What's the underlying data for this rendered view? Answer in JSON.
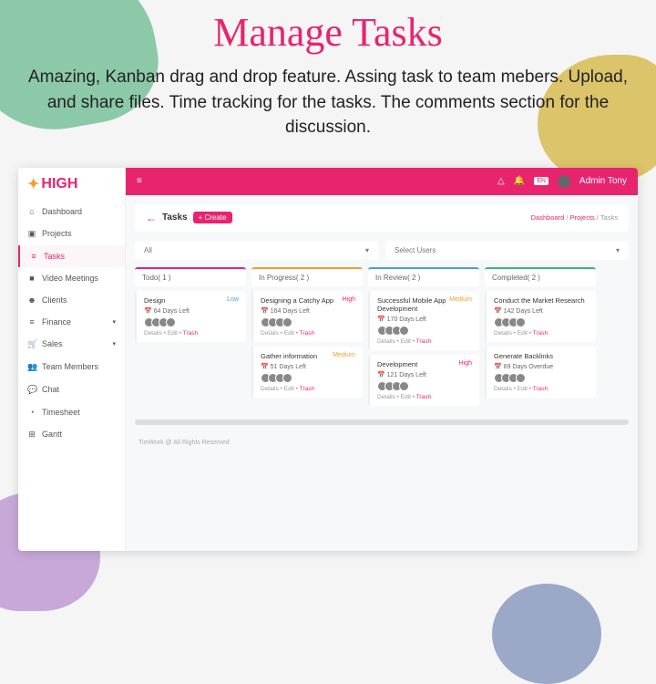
{
  "hero": {
    "title": "Manage Tasks",
    "desc": "Amazing, Kanban drag and drop feature. Assing task to team mebers. Upload, and share files. Time tracking for the tasks. The comments section for the discussion."
  },
  "brand": "HIGH",
  "nav": [
    {
      "icon": "⌂",
      "label": "Dashboard"
    },
    {
      "icon": "▣",
      "label": "Projects"
    },
    {
      "icon": "≡",
      "label": "Tasks",
      "active": true
    },
    {
      "icon": "■",
      "label": "Video Meetings"
    },
    {
      "icon": "☻",
      "label": "Clients"
    },
    {
      "icon": "≡",
      "label": "Finance",
      "caret": true
    },
    {
      "icon": "🛒",
      "label": "Sales",
      "caret": true
    },
    {
      "icon": "👥",
      "label": "Team Members"
    },
    {
      "icon": "💬",
      "label": "Chat"
    },
    {
      "icon": "◔",
      "label": "Timesheet"
    },
    {
      "icon": "⊞",
      "label": "Gantt"
    }
  ],
  "topbar": {
    "user": "Admin Tony"
  },
  "page": {
    "title": "Tasks",
    "create": "+ Create",
    "crumbs": [
      "Dashboard",
      "Projects",
      "Tasks"
    ]
  },
  "filters": {
    "all": "All",
    "users": "Select Users"
  },
  "columns": [
    {
      "title": "Todo( 1 )",
      "cards": [
        {
          "title": "Design",
          "prio": "Low",
          "days": "64 Days Left"
        }
      ]
    },
    {
      "title": "In Progress( 2 )",
      "cards": [
        {
          "title": "Designing a Catchy App",
          "prio": "High",
          "days": "164 Days Left"
        },
        {
          "title": "Gather information",
          "prio": "Medium",
          "days": "51 Days Left"
        }
      ]
    },
    {
      "title": "In Review( 2 )",
      "cards": [
        {
          "title": "Successful Mobile App Development",
          "prio": "Medium",
          "days": "170 Days Left"
        },
        {
          "title": "Development",
          "prio": "High",
          "days": "121 Days Left"
        }
      ]
    },
    {
      "title": "Completed( 2 )",
      "cards": [
        {
          "title": "Conduct the Market Research",
          "prio": "",
          "days": "142 Days Left"
        },
        {
          "title": "Generate Backlinks",
          "prio": "",
          "days": "69 Days Overdue"
        }
      ]
    }
  ],
  "card_actions": {
    "details": "Details",
    "edit": "Edit",
    "trash": "Trash"
  },
  "footer": "TimWork @ All Rights Reserved"
}
